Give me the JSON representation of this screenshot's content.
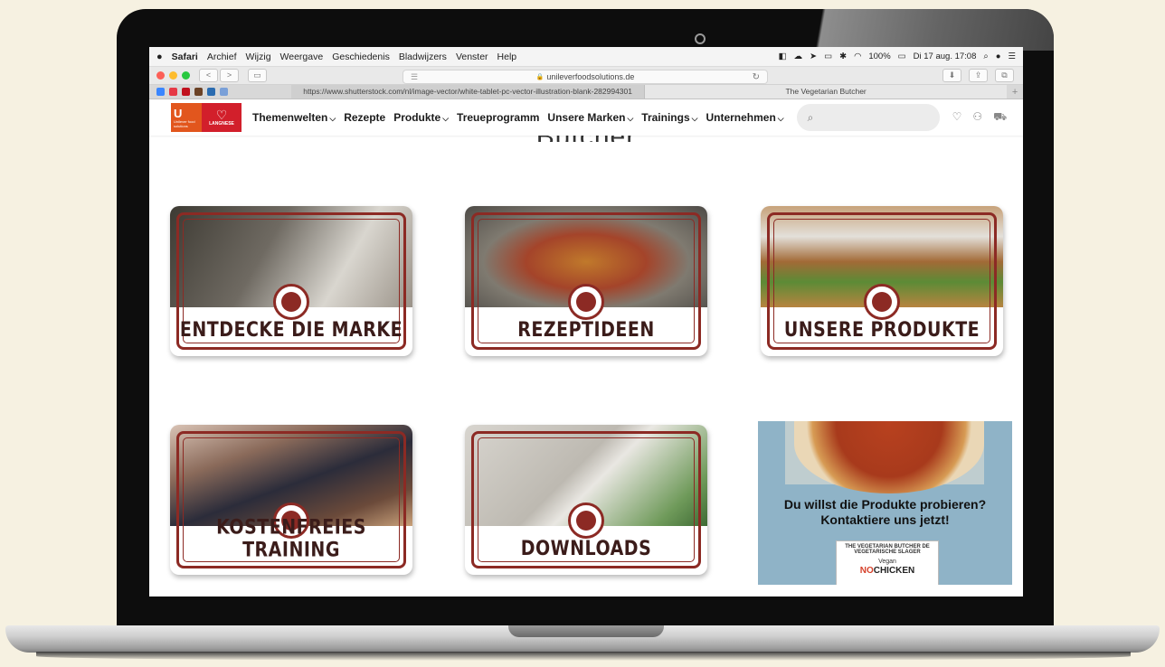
{
  "menubar": {
    "apple": "",
    "app": "Safari",
    "items": [
      "Archief",
      "Wijzig",
      "Weergave",
      "Geschiedenis",
      "Bladwijzers",
      "Venster",
      "Help"
    ],
    "battery": "100%",
    "clock": "Di 17 aug.  17:08"
  },
  "toolbar": {
    "address": "unileverfoodsolutions.de",
    "lock": "🔒",
    "back": "<",
    "forward": ">",
    "sidebar": "▭",
    "reload": "↻"
  },
  "tabs": [
    "https://www.shutterstock.com/nl/image-vector/white-tablet-pc-vector-illustration-blank-282994301",
    "The Vegetarian Butcher"
  ],
  "tab_plus": "+",
  "logos": {
    "ufs_letter": "U",
    "ufs_text": "Unilever food solutions",
    "langnese": "LANGNESE"
  },
  "nav": [
    {
      "label": "Themenwelten",
      "chevron": true
    },
    {
      "label": "Rezepte",
      "chevron": false
    },
    {
      "label": "Produkte",
      "chevron": true
    },
    {
      "label": "Treueprogramm",
      "chevron": false
    },
    {
      "label": "Unsere Marken",
      "chevron": true
    },
    {
      "label": "Trainings",
      "chevron": true
    },
    {
      "label": "Unternehmen",
      "chevron": true
    }
  ],
  "search": {
    "placeholder": ""
  },
  "page_heading": "Butcher",
  "cards": [
    {
      "label": "ENTDECKE DIE MARKE",
      "photo_color": "#6f6a62"
    },
    {
      "label": "REZEPTIDEEN",
      "photo_color": "#8a5a3a"
    },
    {
      "label": "UNSERE PRODUKTE",
      "photo_color": "#a57a4a"
    },
    {
      "label": "KOSTENFREIES TRAINING",
      "photo_color": "#5d4e46"
    },
    {
      "label": "DOWNLOADS",
      "photo_color": "#c9c5bd"
    }
  ],
  "promo": {
    "headline_line1": "Du willst die Produkte probieren?",
    "headline_line2": "Kontaktiere uns jetzt!",
    "pack_brand": "THE VEGETARIAN BUTCHER  DE VEGETARISCHE SLAGER",
    "pack_vegan": "Vegan",
    "pack_no": "NO",
    "pack_chicken": "CHICKEN"
  },
  "colors": {
    "brand_red": "#8c2a24",
    "ufs_orange": "#e2561d",
    "langnese_red": "#d21f2b",
    "page_bg": "#f6f1e1"
  }
}
